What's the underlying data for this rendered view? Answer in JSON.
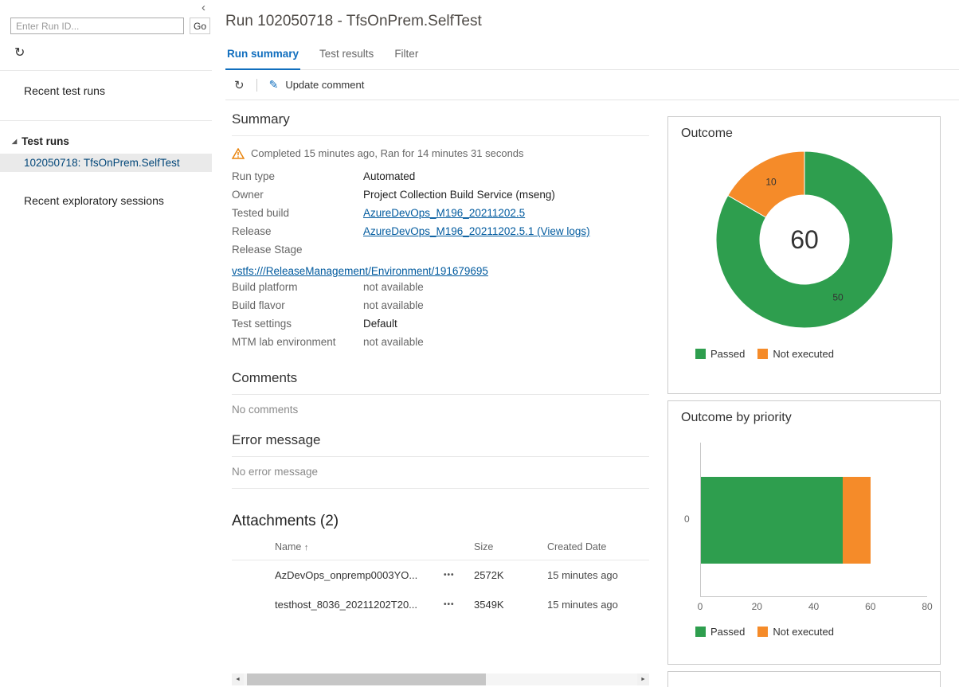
{
  "icons": {
    "collapse_panel": "‹",
    "refresh": "↻",
    "edit_pencil": "✎",
    "tree_expanded": "◢",
    "sort_asc": "↑",
    "more_options": "•••",
    "scroll_left": "◄",
    "scroll_right": "►"
  },
  "sidebar": {
    "run_id_input": {
      "value": "",
      "placeholder": "Enter Run ID..."
    },
    "go_button_label": "Go",
    "recent_test_runs_label": "Recent test runs",
    "tree_header": "Test runs",
    "selected_run": "102050718: TfsOnPrem.SelfTest",
    "recent_exploratory_label": "Recent exploratory sessions"
  },
  "header": {
    "title": "Run 102050718 - TfsOnPrem.SelfTest",
    "tabs": [
      {
        "label": "Run summary",
        "active": true
      },
      {
        "label": "Test results",
        "active": false
      },
      {
        "label": "Filter",
        "active": false
      }
    ]
  },
  "toolbar": {
    "update_comment_label": "Update comment"
  },
  "summary": {
    "heading": "Summary",
    "status_text": "Completed 15 minutes ago, Ran for 14 minutes 31 seconds",
    "fields": [
      {
        "label": "Run type",
        "value": "Automated",
        "link": false,
        "muted": false,
        "fullwidth": false
      },
      {
        "label": "Owner",
        "value": "Project Collection Build Service (mseng)",
        "link": false,
        "muted": false,
        "fullwidth": false
      },
      {
        "label": "Tested build",
        "value": "AzureDevOps_M196_20211202.5",
        "link": true,
        "muted": false,
        "fullwidth": false
      },
      {
        "label": "Release",
        "value": "AzureDevOps_M196_20211202.5.1 (View logs)",
        "link": true,
        "muted": false,
        "fullwidth": false
      },
      {
        "label": "Release Stage",
        "value": "vstfs:///ReleaseManagement/Environment/191679695",
        "link": true,
        "muted": false,
        "fullwidth": true
      },
      {
        "label": "Build platform",
        "value": "not available",
        "link": false,
        "muted": true,
        "fullwidth": false
      },
      {
        "label": "Build flavor",
        "value": "not available",
        "link": false,
        "muted": true,
        "fullwidth": false
      },
      {
        "label": "Test settings",
        "value": "Default",
        "link": false,
        "muted": false,
        "fullwidth": false
      },
      {
        "label": "MTM lab environment",
        "value": "not available",
        "link": false,
        "muted": true,
        "fullwidth": false
      }
    ]
  },
  "comments": {
    "heading": "Comments",
    "empty_text": "No comments"
  },
  "error": {
    "heading": "Error message",
    "empty_text": "No error message"
  },
  "attachments": {
    "heading": "Attachments (2)",
    "columns": [
      "Name",
      "Size",
      "Created Date"
    ],
    "rows": [
      {
        "name": "AzDevOps_onpremp0003YO...",
        "size": "2572K",
        "created": "15 minutes ago"
      },
      {
        "name": "testhost_8036_20211202T20...",
        "size": "3549K",
        "created": "15 minutes ago"
      }
    ]
  },
  "chart_data": [
    {
      "type": "pie",
      "subtype": "donut",
      "title": "Outcome",
      "total_label": "60",
      "slices": [
        {
          "label": "Passed",
          "value": 50,
          "color": "#2E9E4E"
        },
        {
          "label": "Not executed",
          "value": 10,
          "color": "#F58B29"
        }
      ],
      "legend_position": "bottom"
    },
    {
      "type": "bar",
      "orientation": "horizontal",
      "stacked": true,
      "title": "Outcome by priority",
      "categories": [
        "0"
      ],
      "series": [
        {
          "name": "Passed",
          "values": [
            50
          ],
          "color": "#2E9E4E"
        },
        {
          "name": "Not executed",
          "values": [
            10
          ],
          "color": "#F58B29"
        }
      ],
      "xlim": [
        0,
        80
      ],
      "x_ticks": [
        "0",
        "20",
        "40",
        "60",
        "80"
      ],
      "legend_position": "bottom"
    }
  ]
}
